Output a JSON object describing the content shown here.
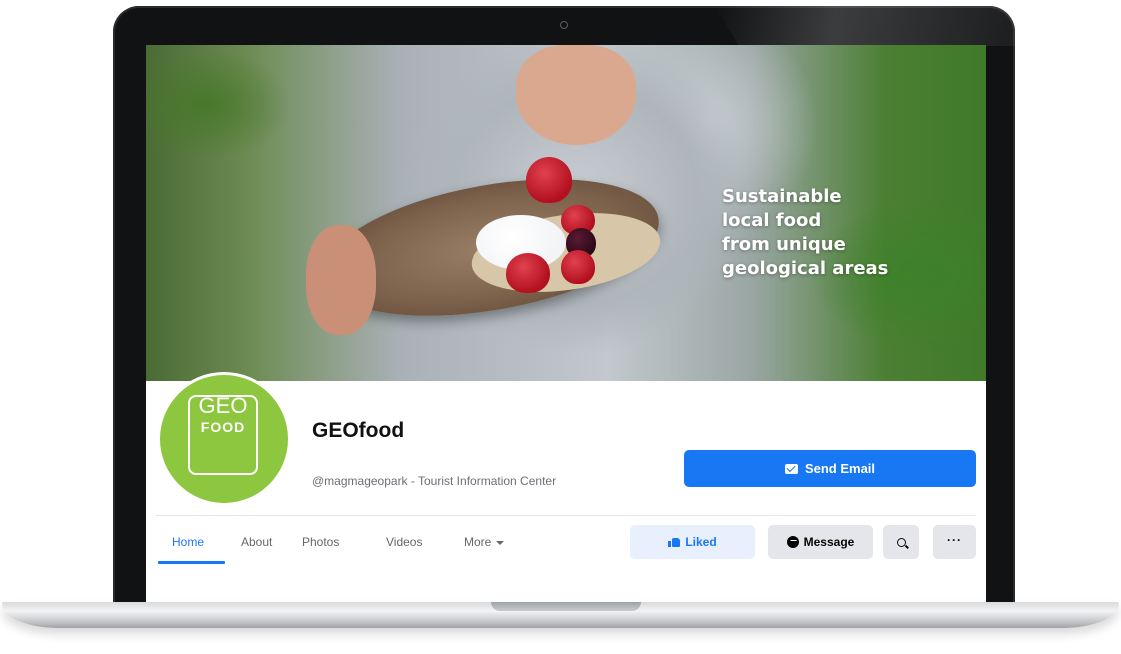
{
  "cover": {
    "tagline": [
      "Sustainable",
      "local food",
      "from unique",
      "geological areas"
    ]
  },
  "profile": {
    "logo_geo": "GEO",
    "logo_food": "FOOD",
    "page_name": "GEOfood",
    "subtitle": "@magmageopark - Tourist Information Center",
    "send_email_label": "Send Email"
  },
  "nav": {
    "tabs": [
      {
        "label": "Home",
        "active": true
      },
      {
        "label": "About",
        "active": false
      },
      {
        "label": "Photos",
        "active": false
      },
      {
        "label": "Videos",
        "active": false
      },
      {
        "label": "More",
        "active": false
      }
    ],
    "liked_label": "Liked",
    "message_label": "Message",
    "more_options_label": "···",
    "icons": {
      "liked": "thumbs-up-icon",
      "message": "messenger-icon",
      "search": "search-icon",
      "send_email": "mail-icon",
      "more_tab": "caret-down-icon"
    }
  },
  "colors": {
    "accent": "#1877f2",
    "logo_green": "#8dc73f"
  }
}
